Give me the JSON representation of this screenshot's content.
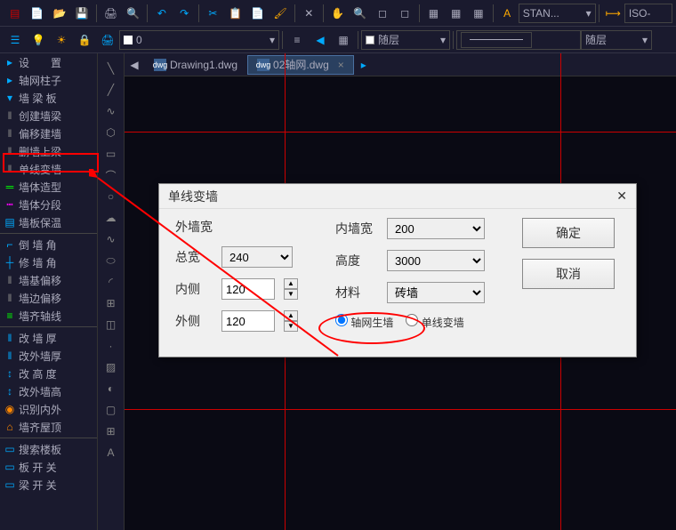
{
  "toolbar2": {
    "layer_num": "0",
    "layer_label": "随层",
    "layer_label2": "随层",
    "style": "STAN...",
    "iso": "ISO-"
  },
  "sidebar": {
    "items": [
      {
        "label": "设　　置",
        "c": "#0af"
      },
      {
        "label": "轴网柱子",
        "c": "#0af"
      },
      {
        "label": "墙 梁 板",
        "c": "#0af"
      },
      {
        "label": "创建墙梁",
        "c": "#0af"
      },
      {
        "label": "偏移建墙",
        "c": "#0af"
      },
      {
        "label": "删墙上梁",
        "c": "#0af"
      },
      {
        "label": "单线变墙",
        "c": "#0af"
      },
      {
        "label": "墙体造型",
        "c": "#0af"
      },
      {
        "label": "墙体分段",
        "c": "#f0f"
      },
      {
        "label": "墙板保温",
        "c": "#0af"
      },
      {
        "label": "倒 墙 角",
        "c": "#0af"
      },
      {
        "label": "修 墙 角",
        "c": "#0af"
      },
      {
        "label": "墙基偏移",
        "c": "#0af"
      },
      {
        "label": "墙边偏移",
        "c": "#0af"
      },
      {
        "label": "墙齐轴线",
        "c": "#0f0"
      },
      {
        "label": "改 墙 厚",
        "c": "#0af"
      },
      {
        "label": "改外墙厚",
        "c": "#0af"
      },
      {
        "label": "改 高 度",
        "c": "#0af"
      },
      {
        "label": "改外墙高",
        "c": "#0af"
      },
      {
        "label": "识别内外",
        "c": "#f80"
      },
      {
        "label": "墙齐屋顶",
        "c": "#f80"
      },
      {
        "label": "搜索楼板",
        "c": "#0af"
      },
      {
        "label": "板 开 关",
        "c": "#0af"
      },
      {
        "label": "梁 开 关",
        "c": "#0af"
      }
    ]
  },
  "tabs": {
    "items": [
      {
        "label": "Drawing1.dwg",
        "active": false
      },
      {
        "label": "02轴网.dwg",
        "active": true
      }
    ]
  },
  "dialog": {
    "title": "单线变墙",
    "outer_width_label": "外墙宽",
    "inner_width_label": "内墙宽",
    "total_width_label": "总宽",
    "total_width": "240",
    "inner_side_label": "内侧",
    "inner_side": "120",
    "outer_side_label": "外侧",
    "outer_side": "120",
    "inner_width": "200",
    "height_label": "高度",
    "height": "3000",
    "material_label": "材料",
    "material": "砖墙",
    "radio1": "轴网生墙",
    "radio2": "单线变墙",
    "ok": "确定",
    "cancel": "取消"
  }
}
